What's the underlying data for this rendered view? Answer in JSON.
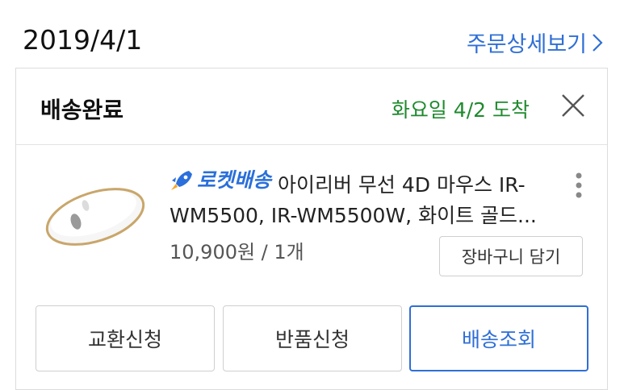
{
  "header": {
    "date": "2019/4/1",
    "detail_link": "주문상세보기"
  },
  "card": {
    "status": "배송완료",
    "arrival": "화요일 4/2 도착",
    "product": {
      "badge": "로켓배송",
      "name_line1": " 아이리버 무선 4D 마우스 IR-",
      "name_line2": "WM5500, IR-WM5500W, 화이트 골드...",
      "price_qty": "10,900원 / 1개"
    },
    "cart_button": "장바구니 담기",
    "actions": {
      "exchange": "교환신청",
      "return": "반품신청",
      "track": "배송조회"
    }
  },
  "colors": {
    "accent_blue": "#2f6fd6",
    "arrival_green": "#1f8a2e",
    "border": "#cfcfcf"
  }
}
